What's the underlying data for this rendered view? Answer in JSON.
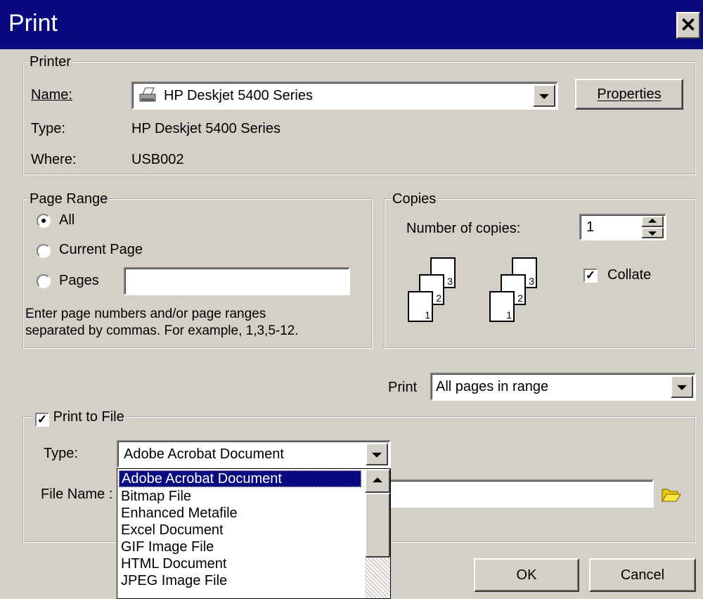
{
  "dialog": {
    "title": "Print",
    "close_icon": "close-icon"
  },
  "printer": {
    "legend": "Printer",
    "name_label": "Name:",
    "name_value": "HP Deskjet 5400 Series",
    "properties_label": "Properties",
    "type_label": "Type:",
    "type_value": "HP Deskjet 5400 Series",
    "where_label": "Where:",
    "where_value": "USB002"
  },
  "page_range": {
    "legend": "Page Range",
    "options": [
      "All",
      "Current Page",
      "Pages"
    ],
    "selected": "All",
    "pages_value": "",
    "hint_line1": "Enter page numbers and/or page ranges",
    "hint_line2": "separated by commas.  For example, 1,3,5-12."
  },
  "copies": {
    "legend": "Copies",
    "number_label": "Number of copies:",
    "number_value": "1",
    "collate_label": "Collate",
    "collate_checked": true,
    "stack_numbers": [
      "1",
      "2",
      "3"
    ]
  },
  "print_what": {
    "label": "Print",
    "value": "All pages in range"
  },
  "print_to_file": {
    "legend": "Print to File",
    "checked": true,
    "type_label": "Type:",
    "type_value": "Adobe Acrobat Document",
    "file_name_label": "File Name :",
    "file_name_value": "",
    "dropdown_items": [
      "Adobe Acrobat Document",
      "Bitmap File",
      "Enhanced Metafile",
      "Excel Document",
      "GIF Image File",
      "HTML Document",
      "JPEG Image File"
    ],
    "selected_item": "Adobe Acrobat Document"
  },
  "buttons": {
    "ok": "OK",
    "cancel": "Cancel"
  }
}
